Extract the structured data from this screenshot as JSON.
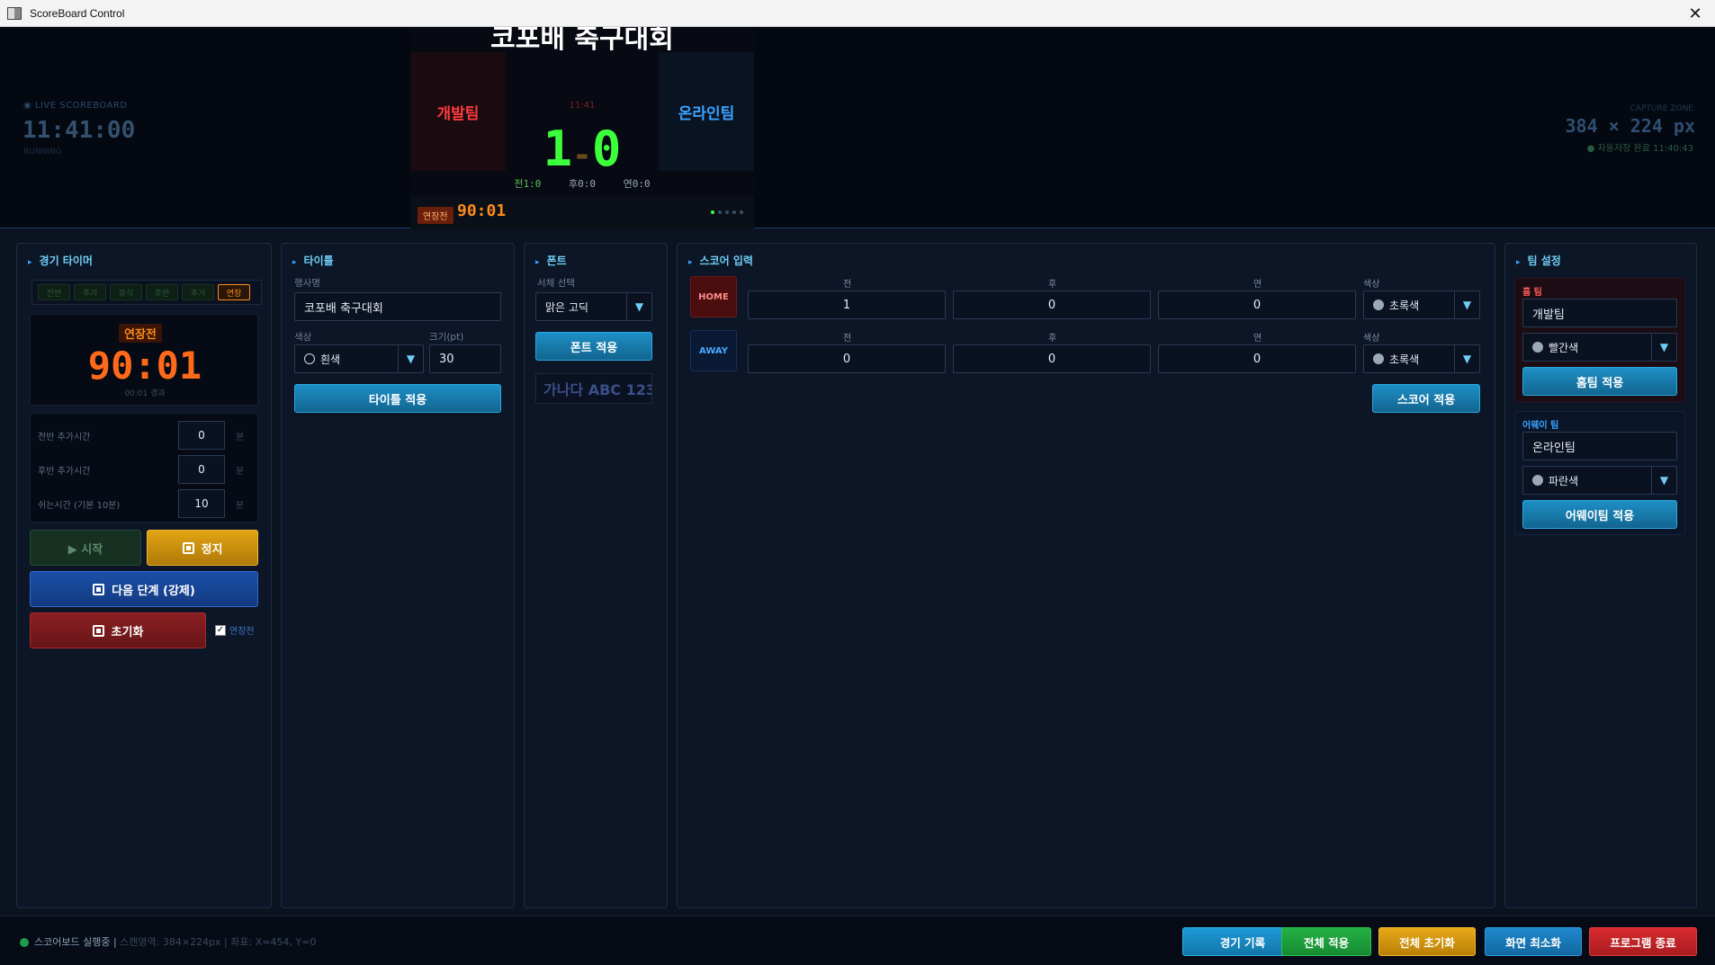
{
  "window": {
    "title": "ScoreBoard Control",
    "close_glyph": "✕"
  },
  "preview": {
    "live_label": "◉ LIVE SCOREBOARD",
    "live_clock": "11:41:00",
    "live_sub": "RUNNING",
    "capture_label": "CAPTURE ZONE",
    "capture_size": "384 × 224 px",
    "autosave": "● 자동저장 완료 11:40:43",
    "board": {
      "title": "코포배 축구대회",
      "home_team": "개발팀",
      "away_team": "온라인팀",
      "small_clock": "11:41",
      "home_score": "1",
      "dash": "-",
      "away_score": "0",
      "halves": [
        "전1:0",
        "후0:0",
        "연0:0"
      ],
      "phase": "연장전",
      "clock": "90:01",
      "dots_total": 5,
      "dots_active": 1
    }
  },
  "timer": {
    "header": "경기 타이머",
    "tabs": [
      "전반",
      "추가",
      "휴식",
      "후반",
      "추가",
      "연장"
    ],
    "active_tab": 5,
    "phase": "연장전",
    "clock": "90:01",
    "elapsed": "00:01 경과",
    "rows": [
      {
        "label": "전반 추가시간",
        "value": "0",
        "unit": "분"
      },
      {
        "label": "후반 추가시간",
        "value": "0",
        "unit": "분"
      },
      {
        "label": "쉬는시간 (기본 10분)",
        "value": "10",
        "unit": "분"
      }
    ],
    "start_label": "▶  시작",
    "stop_label": "정지",
    "next_label": "다음 단계 (강제)",
    "reset_label": "초기화",
    "overtime_check": "연장전"
  },
  "title_panel": {
    "header": "타이틀",
    "event_label": "행사명",
    "event_value": "코포배 축구대회",
    "color_label": "색상",
    "color_value": "흰색",
    "size_label": "크기(pt)",
    "size_value": "30",
    "apply_label": "타이틀 적용"
  },
  "font_panel": {
    "header": "폰트",
    "select_label": "서체 선택",
    "font_value": "맑은 고딕",
    "apply_label": "폰트 적용",
    "preview_text": "가나다 ABC 123"
  },
  "score_panel": {
    "header": "스코어 입력",
    "home_badge": "HOME",
    "away_badge": "AWAY",
    "col_first": "전",
    "col_second": "후",
    "col_extra": "연",
    "col_color": "색상",
    "home_scores": [
      "1",
      "0",
      "0"
    ],
    "away_scores": [
      "0",
      "0",
      "0"
    ],
    "home_color": "초록색",
    "away_color": "초록색",
    "apply_label": "스코어 적용"
  },
  "team_panel": {
    "header": "팀 설정",
    "home_label": "홈 팀",
    "home_name": "개발팀",
    "home_color": "빨간색",
    "home_apply": "홈팀 적용",
    "away_label": "어웨이 팀",
    "away_name": "온라인팀",
    "away_color": "파란색",
    "away_apply": "어웨이팀 적용"
  },
  "status": {
    "running": "스코어보드 실행중  |",
    "size": "  스캔영역: 384×224px   |   좌표: X=454, Y=0"
  },
  "footer_buttons": {
    "record": "경기 기록",
    "apply_all": "전체 적용",
    "reset_all": "전체 초기화",
    "minimize": "화면 최소화",
    "exit": "프로그램 종료"
  },
  "colors": {
    "accent": "#6fcdf5",
    "score_green": "#3cff3c",
    "clock_orange": "#ff6a1a",
    "record_btn": "#1e8fc6",
    "apply_all_btn": "#1f9a3a",
    "reset_all_btn": "#d99a12",
    "minimize_btn": "#1e7fc0",
    "exit_btn": "#c8252a"
  }
}
